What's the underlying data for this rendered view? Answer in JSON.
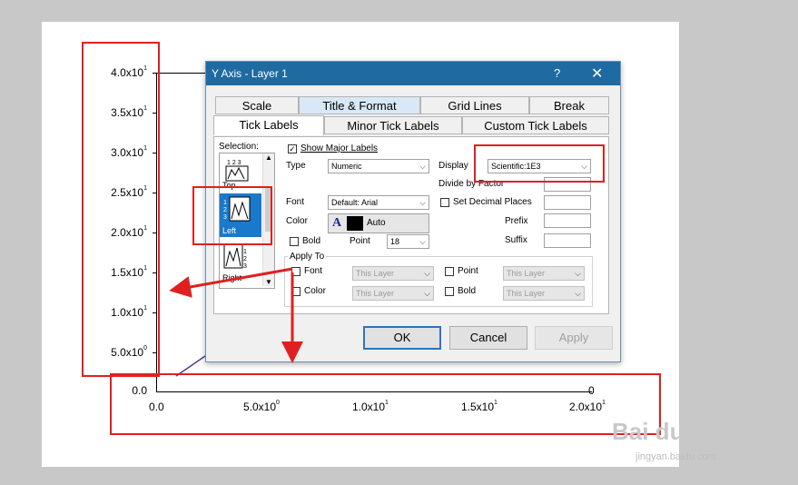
{
  "graph": {
    "y_ticks": [
      {
        "base": "4.0x10",
        "exp": "1"
      },
      {
        "base": "3.5x10",
        "exp": "1"
      },
      {
        "base": "3.0x10",
        "exp": "1"
      },
      {
        "base": "2.5x10",
        "exp": "1"
      },
      {
        "base": "2.0x10",
        "exp": "1"
      },
      {
        "base": "1.5x10",
        "exp": "1"
      },
      {
        "base": "1.0x10",
        "exp": "1"
      },
      {
        "base": "5.0x10",
        "exp": "0"
      }
    ],
    "y_zero": "0.0",
    "x_ticks": [
      {
        "base": "0.0",
        "exp": ""
      },
      {
        "base": "5.0x10",
        "exp": "0"
      },
      {
        "base": "1.0x10",
        "exp": "1"
      },
      {
        "base": "1.5x10",
        "exp": "1"
      },
      {
        "base": "2.0x10",
        "exp": "1"
      }
    ],
    "x_top_zero": "0"
  },
  "dialog": {
    "title": "Y Axis - Layer 1",
    "help": "?",
    "close": "✕",
    "tabs_row1": [
      "Scale",
      "Title & Format",
      "Grid Lines",
      "Break"
    ],
    "tabs_row2": [
      "Tick Labels",
      "Minor Tick Labels",
      "Custom Tick Labels"
    ],
    "selection_label": "Selection:",
    "selection_items": [
      "Top",
      "Left",
      "Right"
    ],
    "show_major_labels": "Show Major Labels",
    "show_major_checked": "✓",
    "type_label": "Type",
    "type_value": "Numeric",
    "display_label": "Display",
    "display_value": "Scientific:1E3",
    "divide_by_factor": "Divide by Factor",
    "font_label": "Font",
    "font_value": "Default: Arial",
    "set_decimal_places": "Set Decimal Places",
    "color_label": "Color",
    "color_glyph": "A",
    "color_value": "Auto",
    "prefix_label": "Prefix",
    "bold_label": "Bold",
    "point_label": "Point",
    "point_value": "18",
    "suffix_label": "Suffix",
    "apply_to": "Apply To",
    "apply_font": "Font",
    "apply_color": "Color",
    "apply_point": "Point",
    "apply_bold": "Bold",
    "this_layer": "This Layer",
    "ok": "OK",
    "cancel": "Cancel",
    "apply": "Apply"
  },
  "watermark": {
    "logo": "Bai du 经验",
    "url": "jingyan.baidu.com"
  }
}
